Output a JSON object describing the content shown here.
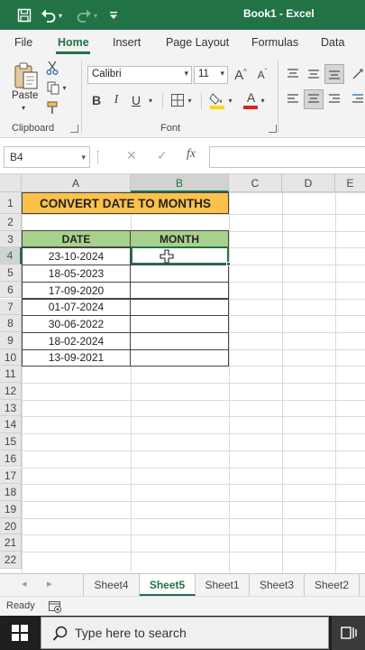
{
  "titlebar": {
    "title": "Book1  -  Excel",
    "icons": [
      "save-icon",
      "undo-icon",
      "redo-icon",
      "customize-toolbar-icon"
    ],
    "color": "#217346"
  },
  "ribbon_tabs": [
    "File",
    "Home",
    "Insert",
    "Page Layout",
    "Formulas",
    "Data"
  ],
  "ribbon_active_tab": "Home",
  "clipboard": {
    "paste_label": "Paste",
    "group_label": "Clipboard"
  },
  "font": {
    "family": "Calibri",
    "size": "11",
    "group_label": "Font",
    "bold": "B",
    "italic": "I",
    "underline": "U",
    "grow": "A",
    "shrink": "A",
    "color_letter": "A",
    "font_color": "#e02020",
    "fill_color": "#ffd700"
  },
  "formula_bar": {
    "name_box": "B4",
    "cancel": "✕",
    "enter": "✓",
    "fx": "fx",
    "value": ""
  },
  "columns": [
    "A",
    "B",
    "C",
    "D",
    "E"
  ],
  "selected_column": "B",
  "rows": [
    "1",
    "2",
    "3",
    "4",
    "5",
    "6",
    "7",
    "8",
    "9",
    "10",
    "11",
    "12",
    "13",
    "14",
    "15",
    "16",
    "17",
    "18",
    "19",
    "20",
    "21",
    "22"
  ],
  "selected_row": "4",
  "sheet": {
    "title": "CONVERT DATE TO MONTHS",
    "header_date": "DATE",
    "header_month": "MONTH",
    "dates": [
      "23-10-2024",
      "18-05-2023",
      "17-09-2020",
      "01-07-2024",
      "30-06-2022",
      "18-02-2024",
      "13-09-2021"
    ],
    "title_fill": "#fcc14b",
    "header_fill": "#a9d18e"
  },
  "sheet_tabs": [
    "Sheet4",
    "Sheet5",
    "Sheet1",
    "Sheet3",
    "Sheet2"
  ],
  "active_sheet": "Sheet5",
  "status": {
    "ready": "Ready"
  },
  "taskbar": {
    "search_placeholder": "Type here to search"
  }
}
